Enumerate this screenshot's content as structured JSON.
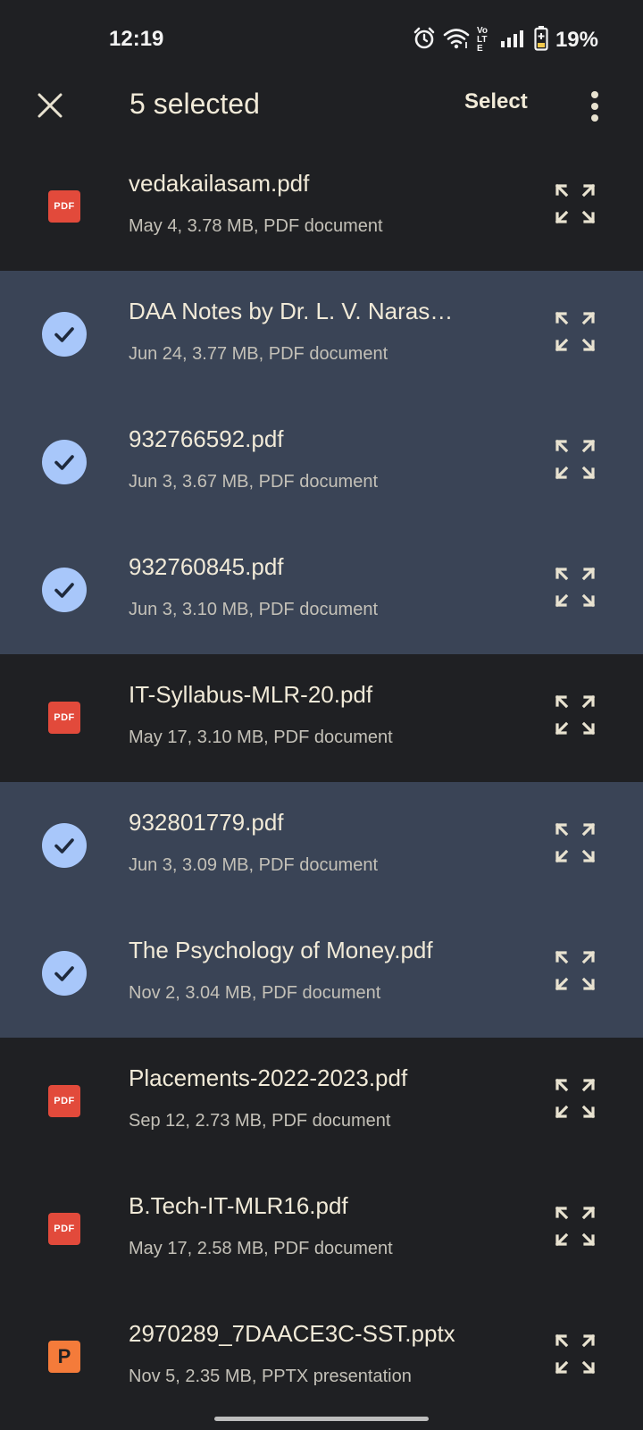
{
  "status_bar": {
    "time": "12:19",
    "battery_percent": "19%",
    "network_label": "Vo LTE",
    "icons": [
      "alarm-icon",
      "wifi-icon",
      "volte-icon",
      "signal-icon",
      "battery-icon"
    ]
  },
  "app_bar": {
    "close_icon": "close-icon",
    "title": "5 selected",
    "select_label": "Select",
    "more_icon": "more-vert-icon"
  },
  "files": [
    {
      "name": "vedakailasam.pdf",
      "meta": "May 4, 3.78 MB, PDF document",
      "type": "pdf",
      "selected": false
    },
    {
      "name": "DAA  Notes by Dr. L. V. Naras…",
      "meta": "Jun 24, 3.77 MB, PDF document",
      "type": "pdf",
      "selected": true
    },
    {
      "name": "932766592.pdf",
      "meta": "Jun 3, 3.67 MB, PDF document",
      "type": "pdf",
      "selected": true
    },
    {
      "name": "932760845.pdf",
      "meta": "Jun 3, 3.10 MB, PDF document",
      "type": "pdf",
      "selected": true
    },
    {
      "name": "IT-Syllabus-MLR-20.pdf",
      "meta": "May 17, 3.10 MB, PDF document",
      "type": "pdf",
      "selected": false
    },
    {
      "name": "932801779.pdf",
      "meta": "Jun 3, 3.09 MB, PDF document",
      "type": "pdf",
      "selected": true
    },
    {
      "name": "The Psychology of Money.pdf",
      "meta": "Nov 2, 3.04 MB, PDF document",
      "type": "pdf",
      "selected": true
    },
    {
      "name": "Placements-2022-2023.pdf",
      "meta": "Sep 12, 2.73 MB, PDF document",
      "type": "pdf",
      "selected": false
    },
    {
      "name": "B.Tech-IT-MLR16.pdf",
      "meta": "May 17, 2.58 MB, PDF document",
      "type": "pdf",
      "selected": false
    },
    {
      "name": "2970289_7DAACE3C-SST.pptx",
      "meta": "Nov 5, 2.35 MB, PPTX presentation",
      "type": "pptx",
      "selected": false
    }
  ],
  "badges": {
    "pdf_label": "PDF",
    "pptx_label": "P"
  },
  "colors": {
    "background": "#1f2023",
    "selected_row": "#3a4456",
    "check_circle": "#a8c7fa",
    "pdf_badge": "#e24a3b",
    "pptx_badge": "#f47b3a",
    "text_primary": "#f1ead8",
    "text_secondary": "#c4c1b8"
  }
}
